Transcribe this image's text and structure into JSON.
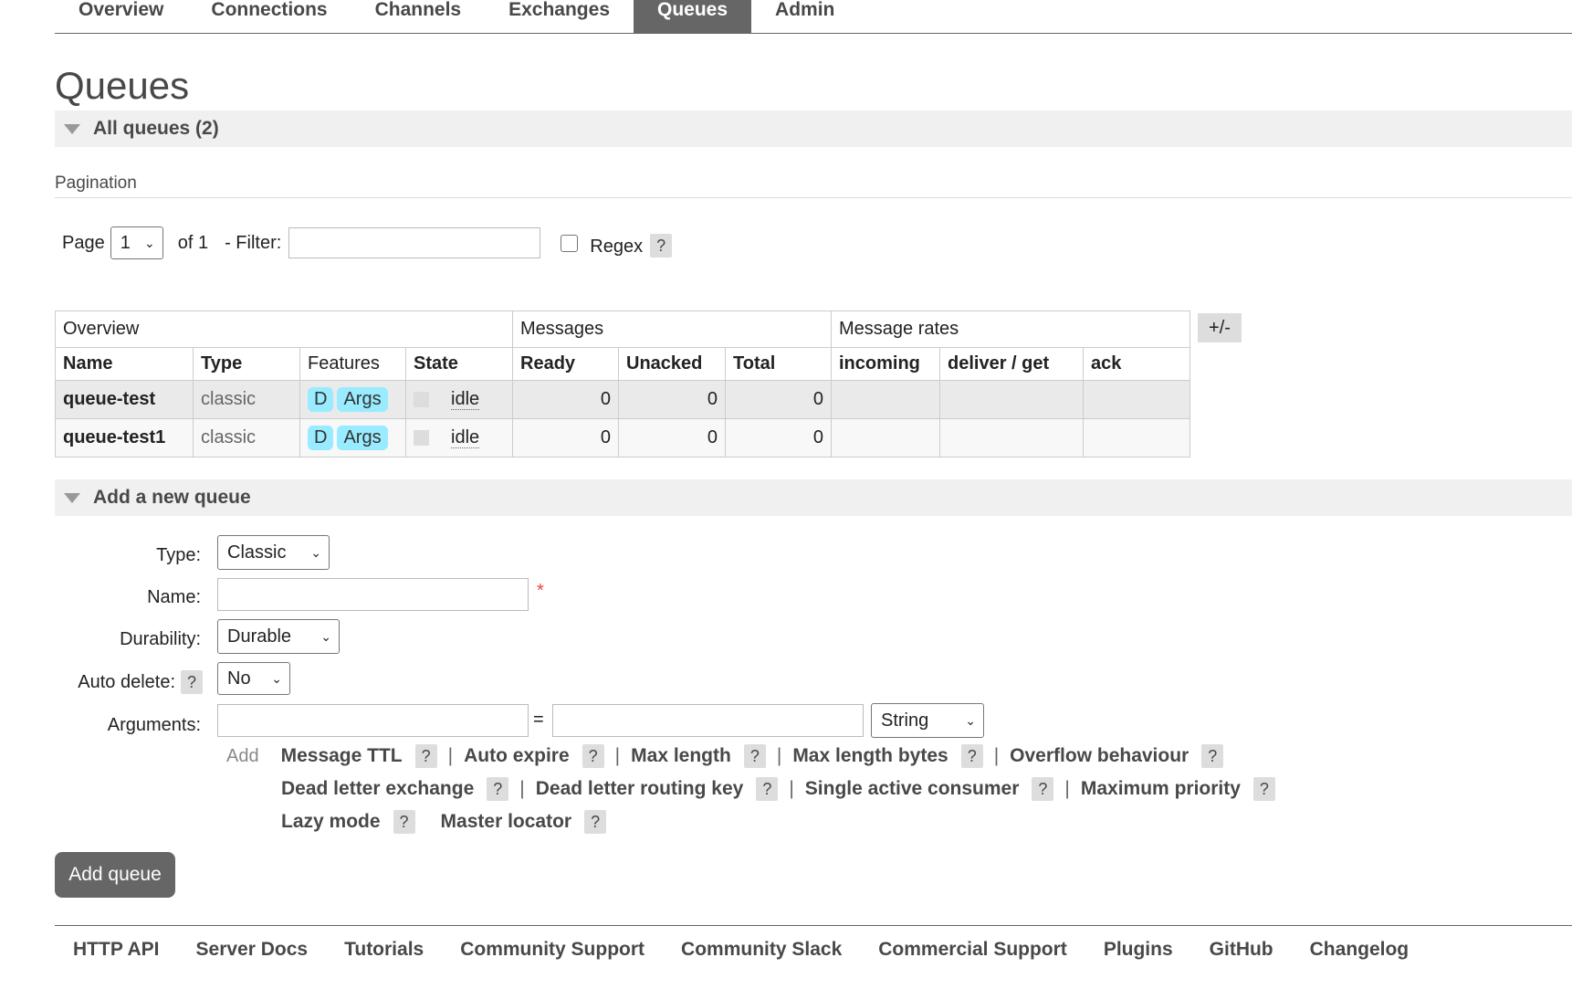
{
  "nav": {
    "items": [
      "Overview",
      "Connections",
      "Channels",
      "Exchanges",
      "Queues",
      "Admin"
    ],
    "active": "Queues"
  },
  "page_title": "Queues",
  "all_queues": {
    "label": "All queues (2)"
  },
  "pagination": {
    "label": "Pagination",
    "page_label": "Page",
    "page_value": "1",
    "of_label": "of 1",
    "filter_label": "- Filter:",
    "filter_value": "",
    "regex_label": "Regex",
    "help": "?"
  },
  "table": {
    "groups": [
      "Overview",
      "Messages",
      "Message rates"
    ],
    "columns": [
      "Name",
      "Type",
      "Features",
      "State",
      "Ready",
      "Unacked",
      "Total",
      "incoming",
      "deliver / get",
      "ack"
    ],
    "rows": [
      {
        "name": "queue-test",
        "type": "classic",
        "feat_d": "D",
        "feat_args": "Args",
        "state": "idle",
        "ready": "0",
        "unacked": "0",
        "total": "0"
      },
      {
        "name": "queue-test1",
        "type": "classic",
        "feat_d": "D",
        "feat_args": "Args",
        "state": "idle",
        "ready": "0",
        "unacked": "0",
        "total": "0"
      }
    ],
    "toggle": "+/-"
  },
  "add_queue": {
    "section_label": "Add a new queue",
    "type_label": "Type:",
    "type_value": "Classic",
    "name_label": "Name:",
    "name_value": "",
    "required_mark": "*",
    "durability_label": "Durability:",
    "durability_value": "Durable",
    "auto_delete_label": "Auto delete:",
    "auto_delete_value": "No",
    "arguments_label": "Arguments:",
    "arg_key": "",
    "arg_value": "",
    "equals": "=",
    "arg_type": "String",
    "add_label": "Add",
    "arg_links": [
      "Message TTL",
      "Auto expire",
      "Max length",
      "Max length bytes",
      "Overflow behaviour",
      "Dead letter exchange",
      "Dead letter routing key",
      "Single active consumer",
      "Maximum priority",
      "Lazy mode",
      "Master locator"
    ],
    "button": "Add queue"
  },
  "footer": {
    "links": [
      "HTTP API",
      "Server Docs",
      "Tutorials",
      "Community Support",
      "Community Slack",
      "Commercial Support",
      "Plugins",
      "GitHub",
      "Changelog"
    ]
  }
}
